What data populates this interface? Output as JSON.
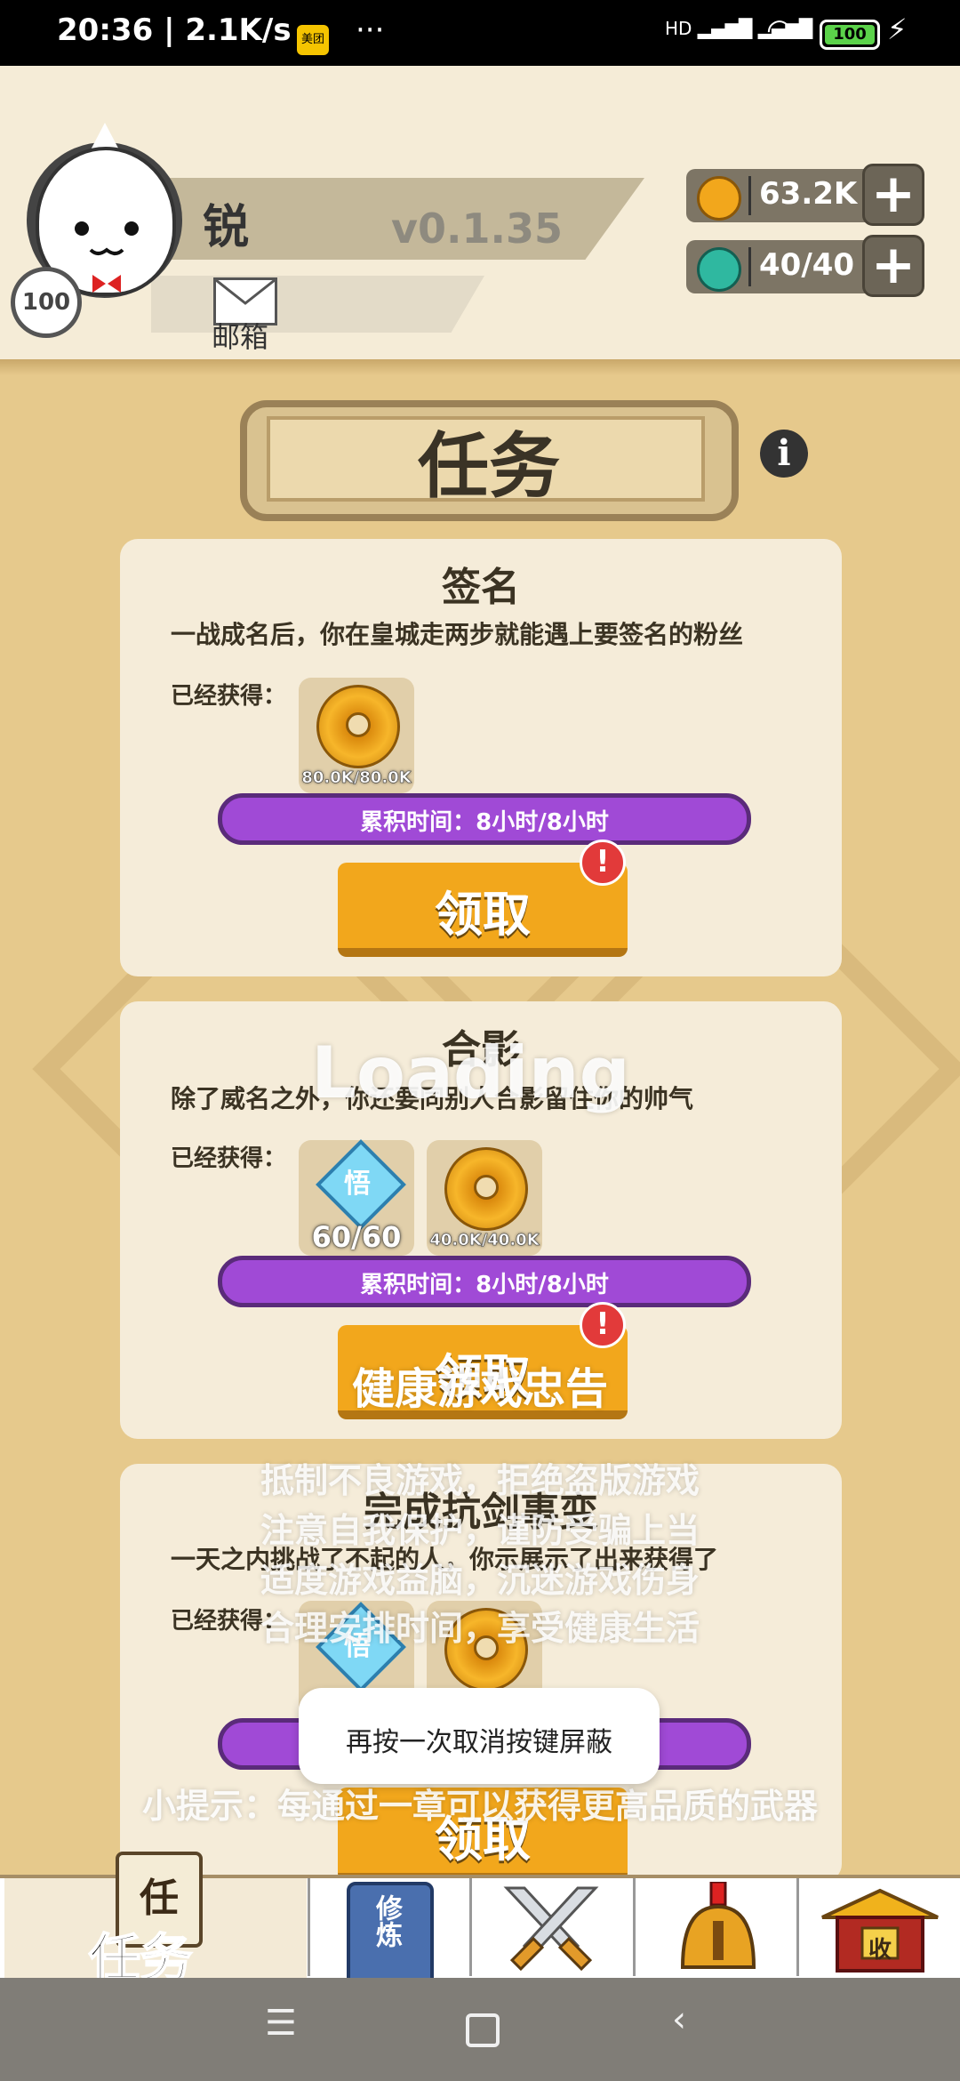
{
  "status_bar": {
    "time": "20:36 | 2.1K/s",
    "app_badge": "美团",
    "more": "···",
    "network": "HD",
    "battery": "100"
  },
  "profile": {
    "name": "锐",
    "version": "v0.1.35",
    "level": "100",
    "mail_label": "邮箱"
  },
  "resources": {
    "gold": "63.2K",
    "energy": "40/40",
    "plus": "+"
  },
  "page": {
    "title": "任务",
    "info": "i"
  },
  "tasks": [
    {
      "title": "签名",
      "desc": "一战成名后，你在皇城走两步就能遇上要签名的粉丝",
      "obtained_label": "已经获得：",
      "rewards": [
        {
          "type": "coin",
          "count": "80.0K/80.0K"
        }
      ],
      "timer": "累积时间：8小时/8小时",
      "claim": "领取",
      "badge": "!"
    },
    {
      "title": "合影",
      "desc": "除了威名之外，你还要同别人合影留住你的帅气",
      "obtained_label": "已经获得：",
      "rewards": [
        {
          "type": "gem",
          "label": "悟",
          "count": "60/60"
        },
        {
          "type": "coin",
          "count": "40.0K/40.0K"
        }
      ],
      "timer": "累积时间：8小时/8小时",
      "claim": "领取",
      "badge": "!"
    },
    {
      "title": "完成抗剑事变",
      "desc": "一天之内挑战了不起的人，你示展示了出来获得了",
      "obtained_label": "已经获得：",
      "rewards": [
        {
          "type": "gem",
          "label": "悟"
        },
        {
          "type": "coin"
        }
      ],
      "claim": "领取"
    }
  ],
  "overlays": {
    "loading": "Loading",
    "notice_title": "健康游戏忠告",
    "notice_lines": [
      "抵制不良游戏，拒绝盗版游戏",
      "注意自我保护，谨防受骗上当",
      "适度游戏益脑，沉迷游戏伤身",
      "合理安排时间，享受健康生活"
    ],
    "toast": "再按一次取消按键屏蔽",
    "tip": "小提示：每通过一章可以获得更高品质的武器"
  },
  "bottom_nav": {
    "task_icon_char": "任",
    "task_label": "任务",
    "train_icon_text": "修炼",
    "shop_icon_text": "收"
  },
  "colors": {
    "accent_gold": "#f2a71c",
    "progress_purple": "#a04ad6",
    "card_bg": "#f5ecd9",
    "page_bg": "#e6c98c"
  }
}
